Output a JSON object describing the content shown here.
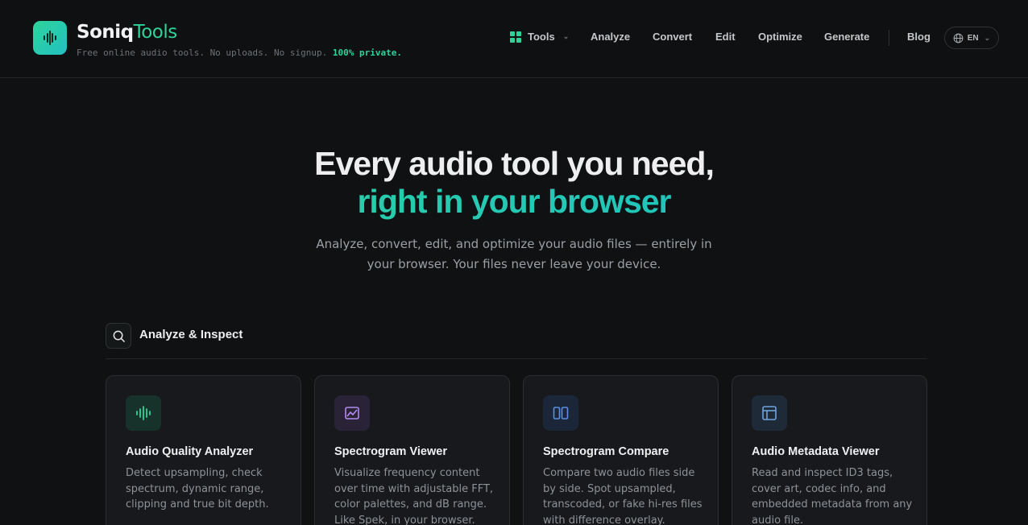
{
  "brand": {
    "name_part1": "Soniq",
    "name_part2": "Tools"
  },
  "tagline": {
    "text": "Free online audio tools. No uploads. No signup.",
    "highlight": "100% private."
  },
  "nav": {
    "tools": "Tools",
    "analyze": "Analyze",
    "convert": "Convert",
    "edit": "Edit",
    "optimize": "Optimize",
    "generate": "Generate",
    "blog": "Blog",
    "lang": "EN"
  },
  "hero": {
    "line1": "Every audio tool you need,",
    "line2": "right in your browser",
    "subtitle": "Analyze, convert, edit, and optimize your audio files — entirely in your browser. Your files never leave your device."
  },
  "section": {
    "title": "Analyze & Inspect"
  },
  "cards": [
    {
      "title": "Audio Quality Analyzer",
      "desc": "Detect upsampling, check spectrum, dynamic range, clipping and true bit depth.",
      "icon": "waveform-icon"
    },
    {
      "title": "Spectrogram Viewer",
      "desc": "Visualize frequency content over time with adjustable FFT, color palettes, and dB range. Like Spek, in your browser.",
      "icon": "image-chart-icon"
    },
    {
      "title": "Spectrogram Compare",
      "desc": "Compare two audio files side by side. Spot upsampled, transcoded, or fake hi-res files with difference overlay.",
      "icon": "columns-icon"
    },
    {
      "title": "Audio Metadata Viewer",
      "desc": "Read and inspect ID3 tags, cover art, codec info, and embedded metadata from any audio file.",
      "icon": "layout-icon"
    }
  ],
  "colors": {
    "accent": "#2fd39a",
    "accent2": "#22b4c8",
    "background": "#0f1112",
    "card": "#17191c"
  }
}
